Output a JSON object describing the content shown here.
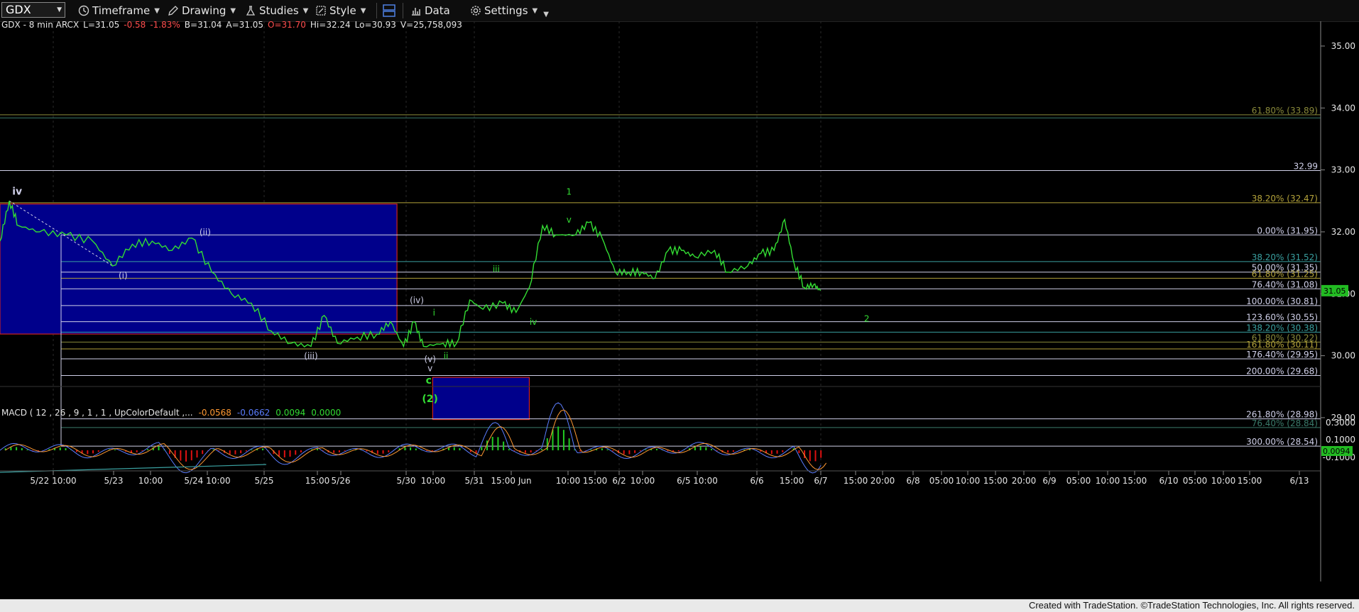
{
  "toolbar": {
    "symbol": "GDX",
    "timeframe": "Timeframe",
    "drawing": "Drawing",
    "studies": "Studies",
    "style": "Style",
    "data": "Data",
    "settings": "Settings"
  },
  "header": {
    "symbol_info": "GDX - 8 min  ARCX",
    "last": "L=31.05",
    "change": "-0.58",
    "pct": "-1.83%",
    "bid": "B=31.04",
    "ask": "A=31.05",
    "open": "O=31.70",
    "high": "Hi=32.24",
    "low": "Lo=30.93",
    "volume": "V=25,758,093"
  },
  "macd": {
    "label": "MACD ( 12 , 26 , 9 , 1 , 1 , UpColorDefault ,...",
    "v1": "-0.0568",
    "v2": "-0.0662",
    "v3": "0.0094",
    "v4": "0.0000",
    "current_badge": "0.0094",
    "axis_ticks": [
      "0.3000",
      "0.1000",
      "-0.1000"
    ]
  },
  "credit": "Created with TradeStation. ©TradeStation Technologies, Inc. All rights reserved.",
  "colors": {
    "price": "#33dd33",
    "macd_line": "#5a7dff",
    "signal_line": "#ff9933",
    "hist_pos": "#22cc22",
    "hist_neg": "#dd1111",
    "box_fill": "#00008b",
    "box_border": "#cc2222"
  },
  "chart_data": {
    "type": "line",
    "title": "GDX - 8 min",
    "xlabel": "",
    "ylabel": "",
    "ylim": [
      27.9,
      35.4
    ],
    "x_ticks": [
      "5/22 10:00",
      "5/23",
      "10:00",
      "5/24 10:00",
      "5/25",
      "15:00",
      "5/26",
      "5/30",
      "10:00",
      "5/31",
      "15:00 Jun",
      "10:00",
      "15:00",
      "6/2",
      "10:00",
      "6/5 10:00",
      "6/6",
      "15:00",
      "6/7",
      "15:00",
      "20:00",
      "6/8",
      "05:00",
      "10:00",
      "15:00",
      "20:00",
      "6/9",
      "05:00",
      "10:00",
      "15:00",
      "6/10",
      "05:00",
      "10:00",
      "15:00",
      "6/13"
    ],
    "y_ticks": [
      35.0,
      34.0,
      33.0,
      32.0,
      31.0,
      30.0,
      29.0
    ],
    "last_price_badge": "31.05",
    "price_series": [
      {
        "t": 0.0,
        "v": 31.85
      },
      {
        "t": 0.7,
        "v": 32.5
      },
      {
        "t": 1.4,
        "v": 32.1
      },
      {
        "t": 3.0,
        "v": 32.0
      },
      {
        "t": 5.0,
        "v": 31.95
      },
      {
        "t": 7.0,
        "v": 31.85
      },
      {
        "t": 8.5,
        "v": 31.45
      },
      {
        "t": 10.0,
        "v": 31.8
      },
      {
        "t": 11.5,
        "v": 31.85
      },
      {
        "t": 13.0,
        "v": 31.7
      },
      {
        "t": 14.5,
        "v": 31.9
      },
      {
        "t": 16.0,
        "v": 31.35
      },
      {
        "t": 17.5,
        "v": 31.0
      },
      {
        "t": 19.0,
        "v": 30.85
      },
      {
        "t": 20.5,
        "v": 30.4
      },
      {
        "t": 22.0,
        "v": 30.2
      },
      {
        "t": 23.5,
        "v": 30.15
      },
      {
        "t": 24.5,
        "v": 30.65
      },
      {
        "t": 25.5,
        "v": 30.2
      },
      {
        "t": 27.0,
        "v": 30.3
      },
      {
        "t": 28.5,
        "v": 30.35
      },
      {
        "t": 29.5,
        "v": 30.55
      },
      {
        "t": 30.5,
        "v": 30.15
      },
      {
        "t": 31.3,
        "v": 30.55
      },
      {
        "t": 32.0,
        "v": 30.15
      },
      {
        "t": 33.5,
        "v": 30.2
      },
      {
        "t": 34.5,
        "v": 30.2
      },
      {
        "t": 35.5,
        "v": 30.9
      },
      {
        "t": 36.5,
        "v": 30.75
      },
      {
        "t": 38.0,
        "v": 30.85
      },
      {
        "t": 39.0,
        "v": 30.7
      },
      {
        "t": 40.0,
        "v": 31.1
      },
      {
        "t": 41.0,
        "v": 32.1
      },
      {
        "t": 42.0,
        "v": 31.95
      },
      {
        "t": 43.5,
        "v": 31.95
      },
      {
        "t": 44.5,
        "v": 32.15
      },
      {
        "t": 45.5,
        "v": 31.9
      },
      {
        "t": 46.5,
        "v": 31.35
      },
      {
        "t": 47.5,
        "v": 31.35
      },
      {
        "t": 48.5,
        "v": 31.35
      },
      {
        "t": 49.5,
        "v": 31.25
      },
      {
        "t": 50.5,
        "v": 31.7
      },
      {
        "t": 51.5,
        "v": 31.7
      },
      {
        "t": 52.5,
        "v": 31.6
      },
      {
        "t": 54.0,
        "v": 31.7
      },
      {
        "t": 55.0,
        "v": 31.35
      },
      {
        "t": 56.5,
        "v": 31.45
      },
      {
        "t": 57.5,
        "v": 31.65
      },
      {
        "t": 58.5,
        "v": 31.7
      },
      {
        "t": 59.3,
        "v": 32.2
      },
      {
        "t": 60.0,
        "v": 31.5
      },
      {
        "t": 60.8,
        "v": 31.1
      },
      {
        "t": 61.5,
        "v": 31.15
      },
      {
        "t": 62.0,
        "v": 31.05
      }
    ],
    "horizontal_levels": [
      {
        "label": "61.80% (33.89)",
        "value": 33.89,
        "color": "#8a8a3a"
      },
      {
        "label": "",
        "value": 33.84,
        "color": "#3a7a6a"
      },
      {
        "label": "32.99",
        "value": 32.99,
        "color": "#cfcfe8"
      },
      {
        "label": "38.20% (32.47)",
        "value": 32.47,
        "color": "#b3a23a"
      },
      {
        "label": "0.00% (31.95)",
        "value": 31.95,
        "color": "#cfcfe8"
      },
      {
        "label": "38.20% (31.52)",
        "value": 31.52,
        "color": "#3aa0a0"
      },
      {
        "label": "50.00% (31.35)",
        "value": 31.35,
        "color": "#cfcfe8"
      },
      {
        "label": "61.80% (31.25)",
        "value": 31.25,
        "color": "#b3a23a"
      },
      {
        "label": "76.40% (31.08)",
        "value": 31.08,
        "color": "#cfcfe8"
      },
      {
        "label": "100.00% (30.81)",
        "value": 30.81,
        "color": "#cfcfe8"
      },
      {
        "label": "123.60% (30.55)",
        "value": 30.55,
        "color": "#cfcfe8"
      },
      {
        "label": "138.20% (30.38)",
        "value": 30.38,
        "color": "#3aa0a0"
      },
      {
        "label": "61.80% (30.22)",
        "value": 30.22,
        "color": "#8a8a3a"
      },
      {
        "label": "161.80% (30.11)",
        "value": 30.11,
        "color": "#b3a23a"
      },
      {
        "label": "176.40% (29.95)",
        "value": 29.95,
        "color": "#cfcfe8"
      },
      {
        "label": "200.00% (29.68)",
        "value": 29.68,
        "color": "#cfcfe8"
      },
      {
        "label": "261.80% (28.98)",
        "value": 28.98,
        "color": "#cfcfe8"
      },
      {
        "label": "76.40% (28.84)",
        "value": 28.84,
        "color": "#3a7a6a"
      },
      {
        "label": "300.00% (28.54)",
        "value": 28.54,
        "color": "#cfcfe8"
      }
    ],
    "boxes": [
      {
        "t0": 0.0,
        "t1": 30.0,
        "top": 32.45,
        "bottom": 30.35
      },
      {
        "t0": 32.7,
        "t1": 40.0,
        "top": 29.65,
        "bottom": 28.97
      }
    ],
    "wave_labels": [
      {
        "text": "iv",
        "t": 1.3,
        "v": 32.6,
        "color": "#cfcfe8",
        "bold": true
      },
      {
        "text": "(i)",
        "t": 9.3,
        "v": 31.25,
        "color": "#cfcfe8"
      },
      {
        "text": "(ii)",
        "t": 15.5,
        "v": 31.95,
        "color": "#cfcfe8"
      },
      {
        "text": "(iii)",
        "t": 23.5,
        "v": 29.95,
        "color": "#cfcfe8"
      },
      {
        "text": "(iv)",
        "t": 31.5,
        "v": 30.85,
        "color": "#cfcfe8"
      },
      {
        "text": "(v)",
        "t": 32.5,
        "v": 29.9,
        "color": "#cfcfe8"
      },
      {
        "text": "i",
        "t": 32.8,
        "v": 30.65,
        "color": "#33dd33"
      },
      {
        "text": "ii",
        "t": 33.7,
        "v": 29.95,
        "color": "#33dd33"
      },
      {
        "text": "iii",
        "t": 37.5,
        "v": 31.35,
        "color": "#33dd33"
      },
      {
        "text": "iv",
        "t": 40.3,
        "v": 30.5,
        "color": "#33dd33"
      },
      {
        "text": "v",
        "t": 32.5,
        "v": 29.75,
        "color": "#cfcfe8"
      },
      {
        "text": "c",
        "t": 32.4,
        "v": 29.55,
        "color": "#33dd33",
        "bold": true
      },
      {
        "text": "(2)",
        "t": 32.5,
        "v": 29.25,
        "color": "#33dd33",
        "bold": true
      },
      {
        "text": "v",
        "t": 43.0,
        "v": 32.15,
        "color": "#33dd33"
      },
      {
        "text": "1",
        "t": 43.0,
        "v": 32.6,
        "color": "#33dd33"
      },
      {
        "text": "2",
        "t": 65.5,
        "v": 30.55,
        "color": "#33dd33"
      }
    ]
  }
}
